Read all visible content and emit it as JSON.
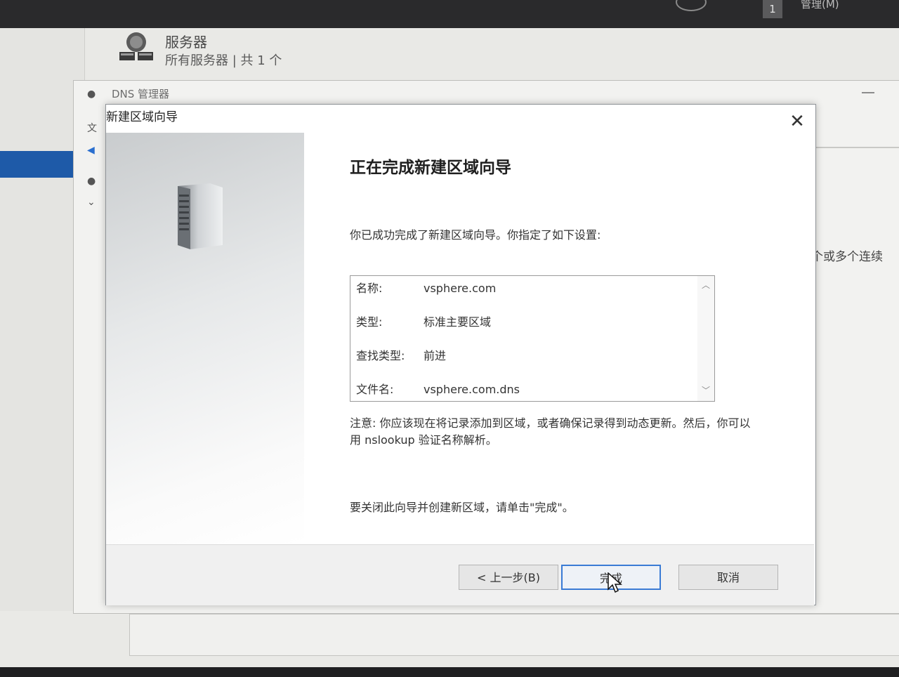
{
  "os": {
    "notification_count": "1",
    "top_menu_label": "管理(M)"
  },
  "server_manager": {
    "title": "服务器",
    "subtitle": "所有服务器 | 共 1 个",
    "icon": "server-group-icon"
  },
  "dns_manager": {
    "title": "DNS 管理器",
    "background_text": "个或多个连续"
  },
  "wizard": {
    "title": "新建区域向导",
    "close_icon": "close-icon",
    "heading": "正在完成新建区域向导",
    "intro": "你已成功完成了新建区域向导。你指定了如下设置:",
    "summary": [
      {
        "key": "名称:",
        "value": "vsphere.com"
      },
      {
        "key": "类型:",
        "value": "标准主要区域"
      },
      {
        "key": "查找类型:",
        "value": "前进"
      },
      {
        "key": "文件名:",
        "value": "vsphere.com.dns"
      }
    ],
    "note": "注意: 你应该现在将记录添加到区域，或者确保记录得到动态更新。然后，你可以用 nslookup 验证名称解析。",
    "closing": "要关闭此向导并创建新区域，请单击\"完成\"。",
    "buttons": {
      "back": "< 上一步(B)",
      "finish": "完成",
      "cancel": "取消"
    }
  }
}
